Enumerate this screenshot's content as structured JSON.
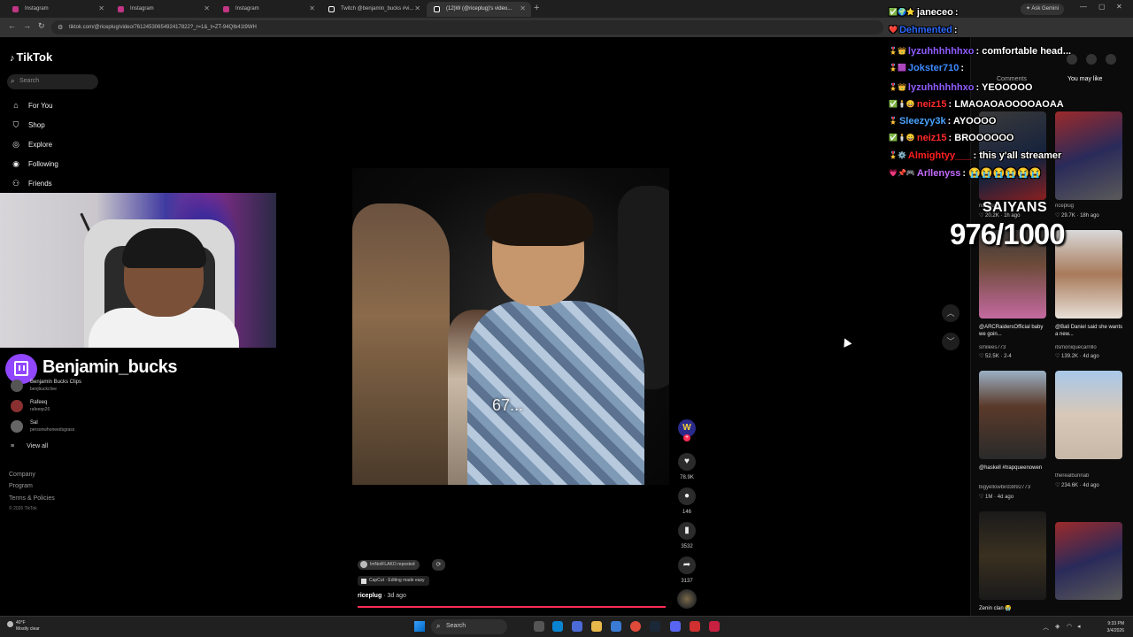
{
  "browser": {
    "tabs": [
      {
        "label": "Instagram",
        "icon": "instagram-icon"
      },
      {
        "label": "Instagram",
        "icon": "instagram-icon"
      },
      {
        "label": "Instagram",
        "icon": "instagram-icon"
      },
      {
        "label": "Twitch @benjamin_bucks #vi...",
        "icon": "tiktok-icon"
      },
      {
        "label": "(12)W (@riceplug)'s video...",
        "icon": "tiktok-icon"
      }
    ],
    "gemini_label": "Ask Gemini",
    "url": "tiktok.com/@riceplug/video/7612453065492417822?_r=1&_t=ZT-94QIb41t9WH"
  },
  "sidebar": {
    "brand": "TikTok",
    "search_placeholder": "Search",
    "nav": [
      {
        "label": "For You",
        "icon": "home-icon"
      },
      {
        "label": "Shop",
        "icon": "shop-icon"
      },
      {
        "label": "Explore",
        "icon": "compass-icon"
      },
      {
        "label": "Following",
        "icon": "following-icon"
      },
      {
        "label": "Friends",
        "icon": "friends-icon"
      }
    ],
    "following_accounts": [
      {
        "name": "Benjamin Bucks Clips",
        "handle": "benjbuckclive"
      },
      {
        "name": "Rafeeq",
        "handle": "rafeeqs26"
      },
      {
        "name": "Sal",
        "handle": "personwhoneedsgrass"
      }
    ],
    "view_all": "View all",
    "footer": [
      "Company",
      "Program",
      "Terms & Policies"
    ],
    "copyright": "© 2026 TikTok"
  },
  "stream": {
    "twitch_name": "Benjamin_bucks"
  },
  "video": {
    "caption": "67...",
    "repost_label": "ImNotFLAKO reposted",
    "capcut_label": "CapCut · Editing made easy",
    "author": "riceplug",
    "posted": "· 3d ago",
    "progress": 0.99
  },
  "actions": {
    "creator_initial": "W",
    "likes": "78.9K",
    "comments": "146",
    "saves": "3532",
    "shares": "3137"
  },
  "right_panel": {
    "tab_comments": "Comments",
    "tab_you_may_like": "You may like",
    "videos": [
      {
        "caption": "",
        "user": "riceplug",
        "likes": "20.2K",
        "age": "1h ago"
      },
      {
        "caption": "",
        "user": "riceplug",
        "likes": "29.7K",
        "age": "18h ago"
      },
      {
        "caption": "@ARCRaidersOfficial baby we goin...",
        "user": "smilees773",
        "likes": "52.5K",
        "age": "2-4"
      },
      {
        "caption": "@Bali Daniel said she wants a new...",
        "user": "itsmoniquecarrillo",
        "likes": "139.2K",
        "age": "4d ago"
      },
      {
        "caption": "@haskell #trapqueenowen",
        "user": "bigyellowbird3892773",
        "likes": "1M",
        "age": "4d ago"
      },
      {
        "caption": "",
        "user": "therealbunnab",
        "likes": "234.6K",
        "age": "4d ago"
      },
      {
        "caption": "Zenin clan 😭",
        "user": "",
        "likes": "",
        "age": ""
      },
      {
        "caption": "",
        "user": "",
        "likes": "",
        "age": ""
      }
    ]
  },
  "chat": [
    {
      "user": "janeceo",
      "color": "#ffffff",
      "text": "",
      "badges": "✅🌍⭐"
    },
    {
      "user": "Dehmented",
      "color": "#2e6bff",
      "text": "",
      "badges": "❤️"
    },
    {
      "user": "lyzuhhhhhhxo",
      "color": "#8f5bff",
      "text": "comfortable head...",
      "badges": "🎖️👑"
    },
    {
      "user": "Jokster710",
      "color": "#3d8bff",
      "text": "",
      "badges": "🎖️🟪"
    },
    {
      "user": "lyzuhhhhhhxo",
      "color": "#8f5bff",
      "text": "YEOOOOO",
      "badges": "🎖️👑"
    },
    {
      "user": "neiz15",
      "color": "#ff2a2a",
      "text": "LMAOAOAOOOOAOAA",
      "badges": "✅🕯️😀"
    },
    {
      "user": "Sleezyy3k",
      "color": "#4aa3ff",
      "text": "AYOOOO",
      "badges": "🎖️"
    },
    {
      "user": "neiz15",
      "color": "#ff2a2a",
      "text": "BROOOOOO",
      "badges": "✅🕯️😀"
    },
    {
      "user": "Almightyy___",
      "color": "#ff1e1e",
      "text": "this y'all streamer",
      "badges": "🎖️⚙️"
    },
    {
      "user": "Arllenyss",
      "color": "#c56bff",
      "text": "😭😭😭😭😭😭",
      "badges": "💗📌🎮"
    }
  ],
  "overlay": {
    "saiyans_label": "SAIYANS",
    "counter": "976/1000"
  },
  "taskbar": {
    "temp": "40°F",
    "weather": "Mostly clear",
    "search_label": "Search",
    "time": "9:33 PM",
    "date": "3/4/2026"
  },
  "colors": {
    "tiktok_red": "#fe2c55",
    "twitch_purple": "#9146ff"
  }
}
